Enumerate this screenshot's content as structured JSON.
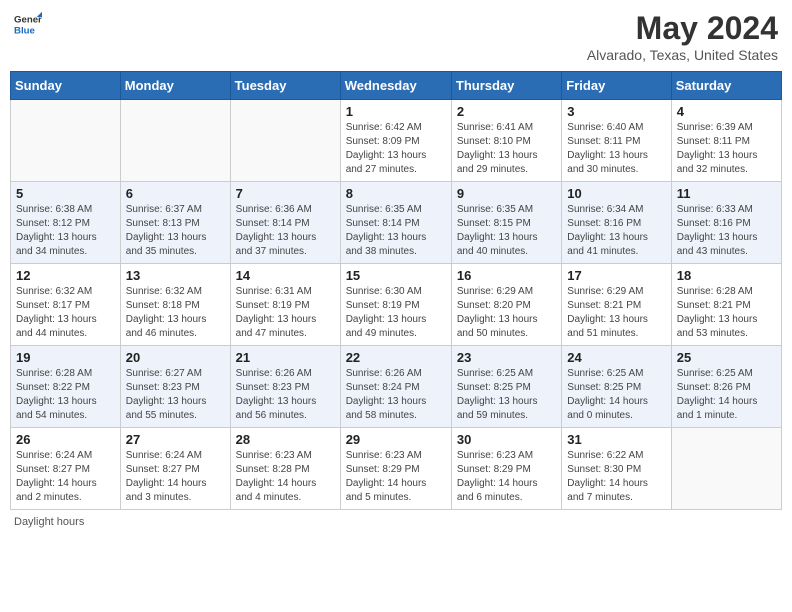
{
  "header": {
    "logo": {
      "general": "General",
      "blue": "Blue"
    },
    "title": "May 2024",
    "location": "Alvarado, Texas, United States"
  },
  "calendar": {
    "days_of_week": [
      "Sunday",
      "Monday",
      "Tuesday",
      "Wednesday",
      "Thursday",
      "Friday",
      "Saturday"
    ],
    "weeks": [
      [
        {
          "day": "",
          "info": ""
        },
        {
          "day": "",
          "info": ""
        },
        {
          "day": "",
          "info": ""
        },
        {
          "day": "1",
          "info": "Sunrise: 6:42 AM\nSunset: 8:09 PM\nDaylight: 13 hours\nand 27 minutes."
        },
        {
          "day": "2",
          "info": "Sunrise: 6:41 AM\nSunset: 8:10 PM\nDaylight: 13 hours\nand 29 minutes."
        },
        {
          "day": "3",
          "info": "Sunrise: 6:40 AM\nSunset: 8:11 PM\nDaylight: 13 hours\nand 30 minutes."
        },
        {
          "day": "4",
          "info": "Sunrise: 6:39 AM\nSunset: 8:11 PM\nDaylight: 13 hours\nand 32 minutes."
        }
      ],
      [
        {
          "day": "5",
          "info": "Sunrise: 6:38 AM\nSunset: 8:12 PM\nDaylight: 13 hours\nand 34 minutes."
        },
        {
          "day": "6",
          "info": "Sunrise: 6:37 AM\nSunset: 8:13 PM\nDaylight: 13 hours\nand 35 minutes."
        },
        {
          "day": "7",
          "info": "Sunrise: 6:36 AM\nSunset: 8:14 PM\nDaylight: 13 hours\nand 37 minutes."
        },
        {
          "day": "8",
          "info": "Sunrise: 6:35 AM\nSunset: 8:14 PM\nDaylight: 13 hours\nand 38 minutes."
        },
        {
          "day": "9",
          "info": "Sunrise: 6:35 AM\nSunset: 8:15 PM\nDaylight: 13 hours\nand 40 minutes."
        },
        {
          "day": "10",
          "info": "Sunrise: 6:34 AM\nSunset: 8:16 PM\nDaylight: 13 hours\nand 41 minutes."
        },
        {
          "day": "11",
          "info": "Sunrise: 6:33 AM\nSunset: 8:16 PM\nDaylight: 13 hours\nand 43 minutes."
        }
      ],
      [
        {
          "day": "12",
          "info": "Sunrise: 6:32 AM\nSunset: 8:17 PM\nDaylight: 13 hours\nand 44 minutes."
        },
        {
          "day": "13",
          "info": "Sunrise: 6:32 AM\nSunset: 8:18 PM\nDaylight: 13 hours\nand 46 minutes."
        },
        {
          "day": "14",
          "info": "Sunrise: 6:31 AM\nSunset: 8:19 PM\nDaylight: 13 hours\nand 47 minutes."
        },
        {
          "day": "15",
          "info": "Sunrise: 6:30 AM\nSunset: 8:19 PM\nDaylight: 13 hours\nand 49 minutes."
        },
        {
          "day": "16",
          "info": "Sunrise: 6:29 AM\nSunset: 8:20 PM\nDaylight: 13 hours\nand 50 minutes."
        },
        {
          "day": "17",
          "info": "Sunrise: 6:29 AM\nSunset: 8:21 PM\nDaylight: 13 hours\nand 51 minutes."
        },
        {
          "day": "18",
          "info": "Sunrise: 6:28 AM\nSunset: 8:21 PM\nDaylight: 13 hours\nand 53 minutes."
        }
      ],
      [
        {
          "day": "19",
          "info": "Sunrise: 6:28 AM\nSunset: 8:22 PM\nDaylight: 13 hours\nand 54 minutes."
        },
        {
          "day": "20",
          "info": "Sunrise: 6:27 AM\nSunset: 8:23 PM\nDaylight: 13 hours\nand 55 minutes."
        },
        {
          "day": "21",
          "info": "Sunrise: 6:26 AM\nSunset: 8:23 PM\nDaylight: 13 hours\nand 56 minutes."
        },
        {
          "day": "22",
          "info": "Sunrise: 6:26 AM\nSunset: 8:24 PM\nDaylight: 13 hours\nand 58 minutes."
        },
        {
          "day": "23",
          "info": "Sunrise: 6:25 AM\nSunset: 8:25 PM\nDaylight: 13 hours\nand 59 minutes."
        },
        {
          "day": "24",
          "info": "Sunrise: 6:25 AM\nSunset: 8:25 PM\nDaylight: 14 hours\nand 0 minutes."
        },
        {
          "day": "25",
          "info": "Sunrise: 6:25 AM\nSunset: 8:26 PM\nDaylight: 14 hours\nand 1 minute."
        }
      ],
      [
        {
          "day": "26",
          "info": "Sunrise: 6:24 AM\nSunset: 8:27 PM\nDaylight: 14 hours\nand 2 minutes."
        },
        {
          "day": "27",
          "info": "Sunrise: 6:24 AM\nSunset: 8:27 PM\nDaylight: 14 hours\nand 3 minutes."
        },
        {
          "day": "28",
          "info": "Sunrise: 6:23 AM\nSunset: 8:28 PM\nDaylight: 14 hours\nand 4 minutes."
        },
        {
          "day": "29",
          "info": "Sunrise: 6:23 AM\nSunset: 8:29 PM\nDaylight: 14 hours\nand 5 minutes."
        },
        {
          "day": "30",
          "info": "Sunrise: 6:23 AM\nSunset: 8:29 PM\nDaylight: 14 hours\nand 6 minutes."
        },
        {
          "day": "31",
          "info": "Sunrise: 6:22 AM\nSunset: 8:30 PM\nDaylight: 14 hours\nand 7 minutes."
        },
        {
          "day": "",
          "info": ""
        }
      ]
    ]
  },
  "footer": {
    "note": "Daylight hours"
  }
}
